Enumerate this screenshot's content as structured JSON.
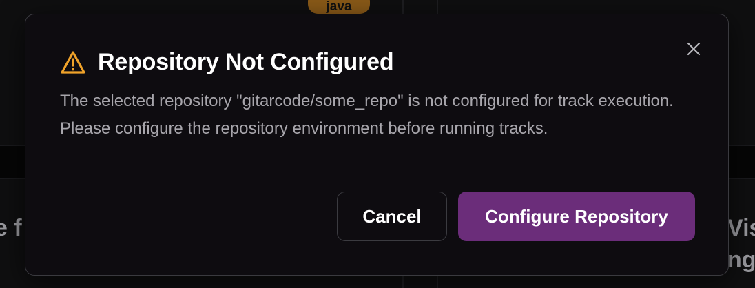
{
  "background": {
    "tag_label": "java",
    "left_fragment": "e f",
    "right_fragment_line1": "Vis",
    "right_fragment_line2": "ng"
  },
  "modal": {
    "title": "Repository Not Configured",
    "message": "The selected repository \"gitarcode/some_repo\" is not configured for track execution. Please configure the repository environment before running tracks.",
    "close_icon": "close-icon",
    "warning_icon": "warning-triangle-icon",
    "cancel_label": "Cancel",
    "confirm_label": "Configure Repository"
  },
  "colors": {
    "warning": "#f0a32a",
    "primary_button": "#6b2d7a",
    "modal_bg": "#0e0c10",
    "border": "#3a3a3f"
  }
}
